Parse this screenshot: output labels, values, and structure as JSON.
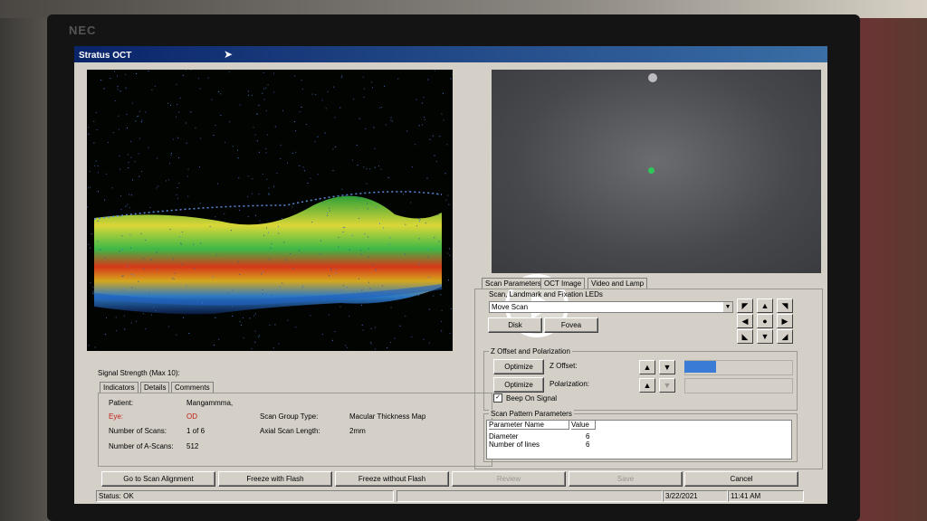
{
  "monitor": {
    "brand": "NEC"
  },
  "window": {
    "title": "Stratus OCT"
  },
  "left": {
    "signal_label": "Signal Strength (Max 10):",
    "tabs": [
      "Indicators",
      "Details",
      "Comments"
    ],
    "fields": {
      "patient_label": "Patient:",
      "patient_value": "Mangammma,",
      "eye_label": "Eye:",
      "eye_value": "OD",
      "num_scans_label": "Number of Scans:",
      "num_scans_value": "1 of 6",
      "num_ascans_label": "Number of A-Scans:",
      "num_ascans_value": "512",
      "scan_group_label": "Scan Group Type:",
      "scan_group_value": "Macular Thickness Map",
      "axial_label": "Axial Scan Length:",
      "axial_value": "2mm"
    }
  },
  "right": {
    "tabs": [
      "Scan Parameters",
      "OCT Image",
      "Video and Lamp"
    ],
    "scan_landmark_title": "Scan, Landmark and Fixation LEDs",
    "move_select": "Move Scan",
    "disk_button": "Disk",
    "fovea_button": "Fovea",
    "arrows": [
      "◤",
      "▲",
      "◥",
      "◀",
      "●",
      "▶",
      "◣",
      "▼",
      "◢"
    ],
    "z_title": "Z Offset and Polarization",
    "optimize1": "Optimize",
    "z_offset_label": "Z Offset:",
    "optimize2": "Optimize",
    "polarization_label": "Polarization:",
    "beep_label": "Beep On Signal",
    "beep_checked": "✓",
    "pattern_title": "Scan Pattern Parameters",
    "table_headers": [
      "Parameter Name",
      "Value"
    ],
    "table_rows": [
      [
        "Diameter",
        "6"
      ],
      [
        "Number of lines",
        "6"
      ]
    ]
  },
  "bottom": {
    "buttons": [
      "Go to Scan Alignment",
      "Freeze with Flash",
      "Freeze without Flash",
      "Review",
      "Save",
      "Cancel"
    ],
    "status": "Status: OK",
    "date": "3/22/2021",
    "time": "11:41 AM"
  },
  "colors": {
    "title_bar": "#0a246a",
    "window_bg": "#d4d0c8",
    "z_offset_bar": "#3a7bd5",
    "fixation_led": "#2fc65a"
  },
  "icons": [
    "cursor-arrow-icon",
    "play-icon"
  ]
}
